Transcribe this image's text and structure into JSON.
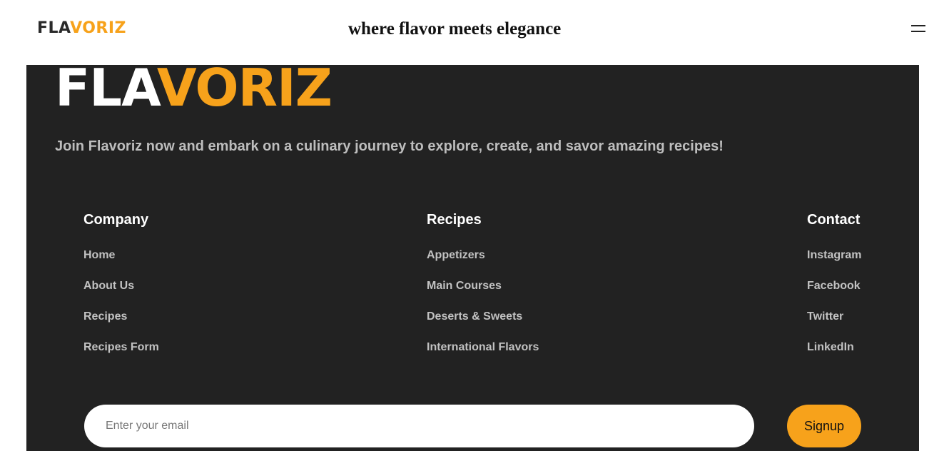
{
  "header": {
    "logo": {
      "part1": "FLA",
      "part2": "VORIZ"
    },
    "tagline": "where flavor meets elegance",
    "menu_icon": "hamburger-menu-icon"
  },
  "footer": {
    "logo": {
      "part1": "FLA",
      "part2": "VORIZ"
    },
    "intro": "Join Flavoriz now and embark on a culinary journey to explore, create, and savor amazing recipes!",
    "columns": [
      {
        "title": "Company",
        "links": [
          "Home",
          "About Us",
          "Recipes",
          "Recipes Form"
        ]
      },
      {
        "title": "Recipes",
        "links": [
          "Appetizers",
          "Main Courses",
          "Deserts & Sweets",
          "International Flavors"
        ]
      },
      {
        "title": "Contact",
        "links": [
          "Instagram",
          "Facebook",
          "Twitter",
          "LinkedIn"
        ]
      }
    ],
    "newsletter": {
      "placeholder": "Enter your email",
      "value": "",
      "button_label": "Signup"
    }
  },
  "colors": {
    "accent": "#f7a21b",
    "footer_bg": "#222222",
    "text_muted": "#bdbdbd"
  }
}
